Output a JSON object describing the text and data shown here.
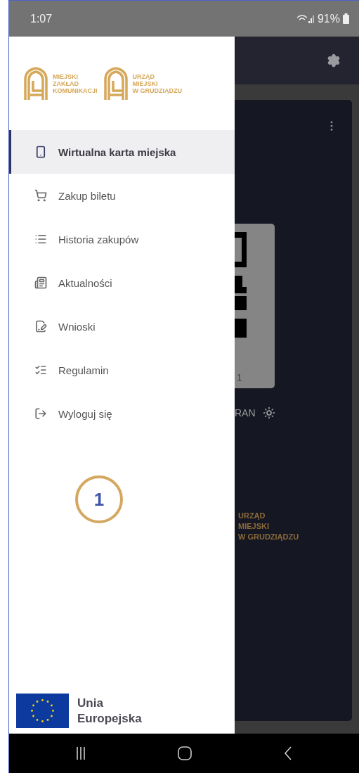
{
  "status_bar": {
    "time": "1:07",
    "battery": "91%"
  },
  "drawer": {
    "logos": [
      {
        "lines": [
          "MIEJSKI",
          "ZAKŁAD",
          "KOMUNIKACJI"
        ]
      },
      {
        "lines": [
          "URZĄD",
          "MIEJSKI",
          "W GRUDZIĄDZU"
        ]
      }
    ],
    "items": [
      {
        "label": "Wirtualna karta miejska",
        "selected": true
      },
      {
        "label": "Zakup biletu",
        "selected": false
      },
      {
        "label": "Historia zakupów",
        "selected": false
      },
      {
        "label": "Aktualności",
        "selected": false
      },
      {
        "label": "Wnioski",
        "selected": false
      },
      {
        "label": "Regulamin",
        "selected": false
      },
      {
        "label": "Wyloguj się",
        "selected": false
      }
    ],
    "eu": {
      "lines": [
        "Unia",
        "Europejska"
      ]
    }
  },
  "background": {
    "qr_caption": "1",
    "brightness_label": "RAN",
    "logo_lines": [
      "URZĄD",
      "MIEJSKI",
      "W GRUDZIĄDZU"
    ]
  },
  "annotation": {
    "number": "1"
  }
}
